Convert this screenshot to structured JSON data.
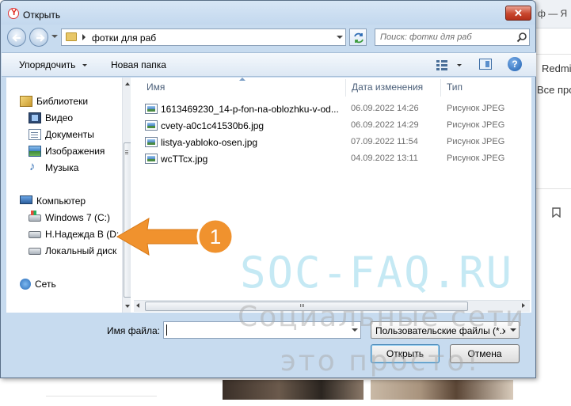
{
  "browser_bg": {
    "tab_fragment": "ф — Я",
    "text_redmi": "Redmi",
    "text_vse": "Все про"
  },
  "dialog": {
    "title": "Открыть",
    "close_label": "✕",
    "address": {
      "path": "фотки для раб"
    },
    "search": {
      "placeholder": "Поиск: фотки для раб"
    },
    "toolbar": {
      "organize_label": "Упорядочить",
      "new_folder_label": "Новая папка",
      "help_label": "?"
    },
    "nav": {
      "groups": [
        {
          "label": "Библиотеки",
          "icon": "library-icon",
          "items": [
            {
              "label": "Видео",
              "icon": "video-icon"
            },
            {
              "label": "Документы",
              "icon": "documents-icon"
            },
            {
              "label": "Изображения",
              "icon": "pictures-icon"
            },
            {
              "label": "Музыка",
              "icon": "music-icon"
            }
          ]
        },
        {
          "label": "Компьютер",
          "icon": "computer-icon",
          "items": [
            {
              "label": "Windows 7 (C:)",
              "icon": "system-drive-icon"
            },
            {
              "label": "Н.Надежда В (D:",
              "icon": "drive-icon"
            },
            {
              "label": "Локальный диск",
              "icon": "drive-icon"
            }
          ]
        },
        {
          "label": "Сеть",
          "icon": "network-icon",
          "items": []
        }
      ]
    },
    "columns": {
      "name": "Имя",
      "date": "Дата изменения",
      "type": "Тип"
    },
    "files": [
      {
        "name": "1613469230_14-p-fon-na-oblozhku-v-od...",
        "date": "06.09.2022 14:26",
        "type": "Рисунок JPEG"
      },
      {
        "name": "cvety-a0c1c41530b6.jpg",
        "date": "06.09.2022 14:29",
        "type": "Рисунок JPEG"
      },
      {
        "name": "listya-yabloko-osen.jpg",
        "date": "07.09.2022 11:54",
        "type": "Рисунок JPEG"
      },
      {
        "name": "wcTTcx.jpg",
        "date": "04.09.2022 13:11",
        "type": "Рисунок JPEG"
      }
    ],
    "filename": {
      "label": "Имя файла:",
      "value": ""
    },
    "filetype": {
      "selected": "Пользовательские файлы (*.x"
    },
    "buttons": {
      "open": "Открыть",
      "cancel": "Отмена"
    }
  },
  "annotation": {
    "number": "1",
    "color": "#f0922e"
  },
  "watermark": {
    "line1": "SOC-FAQ.RU",
    "line2": "Социальные сети",
    "line3": "это просто!"
  }
}
